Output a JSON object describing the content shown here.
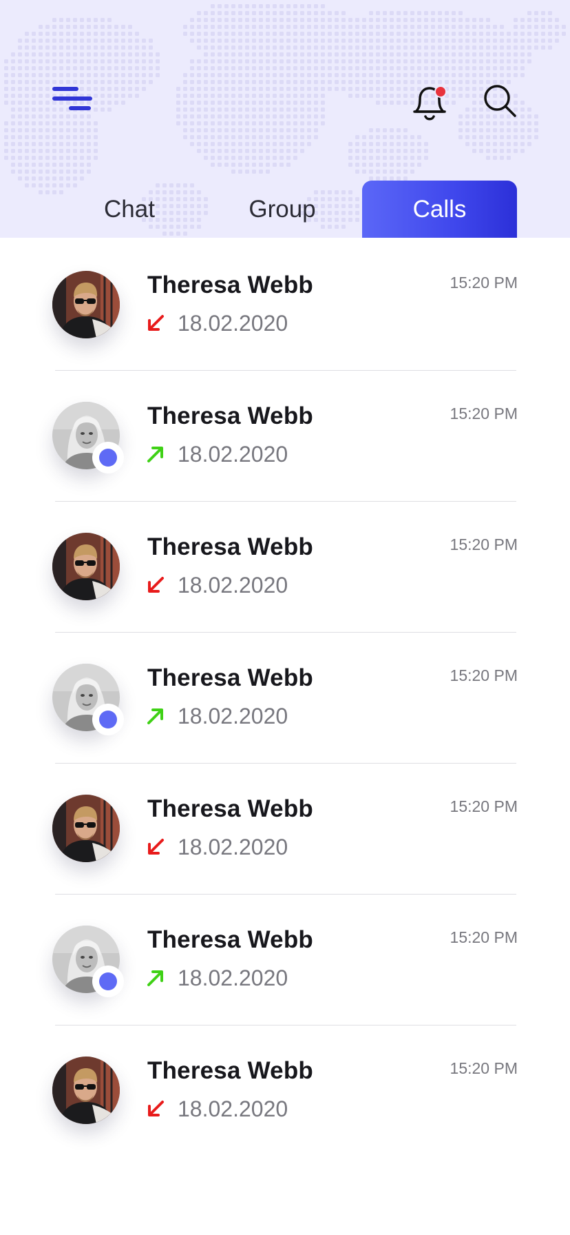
{
  "header": {
    "menu_icon": "menu-icon",
    "notification_icon": "bell-icon",
    "notification_badge_color": "#e8323c",
    "search_icon": "search-icon"
  },
  "tabs": [
    {
      "label": "Chat",
      "active": false
    },
    {
      "label": "Group",
      "active": false
    },
    {
      "label": "Calls",
      "active": true
    }
  ],
  "colors": {
    "accent": "#5b67f7",
    "accent_dark": "#2c30d8",
    "header_bg": "#ecebfd",
    "incoming_arrow": "#e81b1b",
    "outgoing_arrow": "#3fd116",
    "online_dot": "#5e6af5"
  },
  "calls": [
    {
      "name": "Theresa Webb",
      "date": "18.02.2020",
      "time": "15:20 PM",
      "direction": "incoming",
      "avatar": "man-sunglasses",
      "online": false
    },
    {
      "name": "Theresa Webb",
      "date": "18.02.2020",
      "time": "15:20 PM",
      "direction": "outgoing",
      "avatar": "woman-blonde",
      "online": true
    },
    {
      "name": "Theresa Webb",
      "date": "18.02.2020",
      "time": "15:20 PM",
      "direction": "incoming",
      "avatar": "man-sunglasses",
      "online": false
    },
    {
      "name": "Theresa Webb",
      "date": "18.02.2020",
      "time": "15:20 PM",
      "direction": "outgoing",
      "avatar": "woman-blonde",
      "online": true
    },
    {
      "name": "Theresa Webb",
      "date": "18.02.2020",
      "time": "15:20 PM",
      "direction": "incoming",
      "avatar": "man-sunglasses",
      "online": false
    },
    {
      "name": "Theresa Webb",
      "date": "18.02.2020",
      "time": "15:20 PM",
      "direction": "outgoing",
      "avatar": "woman-blonde",
      "online": true
    },
    {
      "name": "Theresa Webb",
      "date": "18.02.2020",
      "time": "15:20 PM",
      "direction": "incoming",
      "avatar": "man-sunglasses",
      "online": false
    }
  ]
}
